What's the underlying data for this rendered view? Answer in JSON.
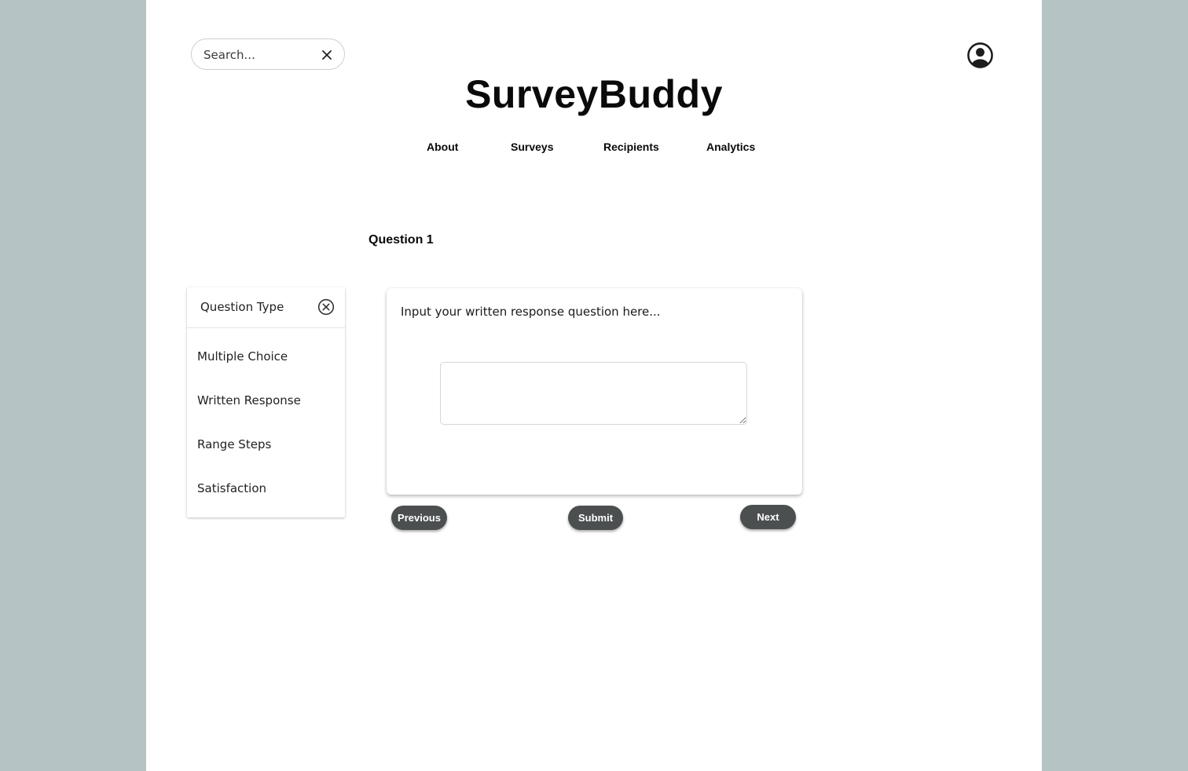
{
  "search": {
    "placeholder": "Search...",
    "clear_icon": "close-icon"
  },
  "header": {
    "brand": "SurveyBuddy",
    "account_icon": "user-circle-icon"
  },
  "nav": {
    "items": [
      {
        "label": "About"
      },
      {
        "label": "Surveys"
      },
      {
        "label": "Recipients"
      },
      {
        "label": "Analytics"
      }
    ]
  },
  "question": {
    "title": "Question 1",
    "prompt": "Input your written response question here...",
    "response_value": ""
  },
  "question_type": {
    "label": "Question Type",
    "close_icon": "circle-x-icon",
    "options": [
      {
        "label": "Multiple Choice"
      },
      {
        "label": "Written Response"
      },
      {
        "label": "Range Steps"
      },
      {
        "label": "Satisfaction"
      }
    ]
  },
  "actions": {
    "previous_label": "Previous",
    "submit_label": "Submit",
    "next_label": "Next"
  },
  "colors": {
    "background": "#b5c3c4",
    "page": "#ffffff",
    "button": "#4b4f4f",
    "button_text": "#ffffff"
  }
}
